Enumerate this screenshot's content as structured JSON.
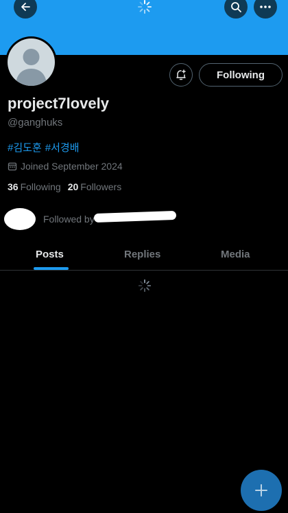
{
  "profile": {
    "display_name": "project7lovely",
    "handle": "@ganghuks",
    "hashtags": [
      "#김도훈",
      "#서경배"
    ],
    "joined": "Joined September 2024",
    "following_count": "36",
    "following_label": "Following",
    "followers_count": "20",
    "followers_label": "Followers",
    "followed_by": "Followed by"
  },
  "actions": {
    "following_button": "Following"
  },
  "tabs": [
    {
      "label": "Posts",
      "active": true
    },
    {
      "label": "Replies",
      "active": false
    },
    {
      "label": "Media",
      "active": false
    }
  ],
  "icons": {
    "back": "arrow-left-icon",
    "search": "search-icon",
    "more": "more-horizontal-icon",
    "notify": "bell-plus-icon",
    "calendar": "calendar-icon",
    "compose": "plus-icon",
    "loading": "spinner-icon"
  },
  "colors": {
    "accent": "#1d9bf0",
    "background": "#000000",
    "muted_text": "#71767b"
  }
}
